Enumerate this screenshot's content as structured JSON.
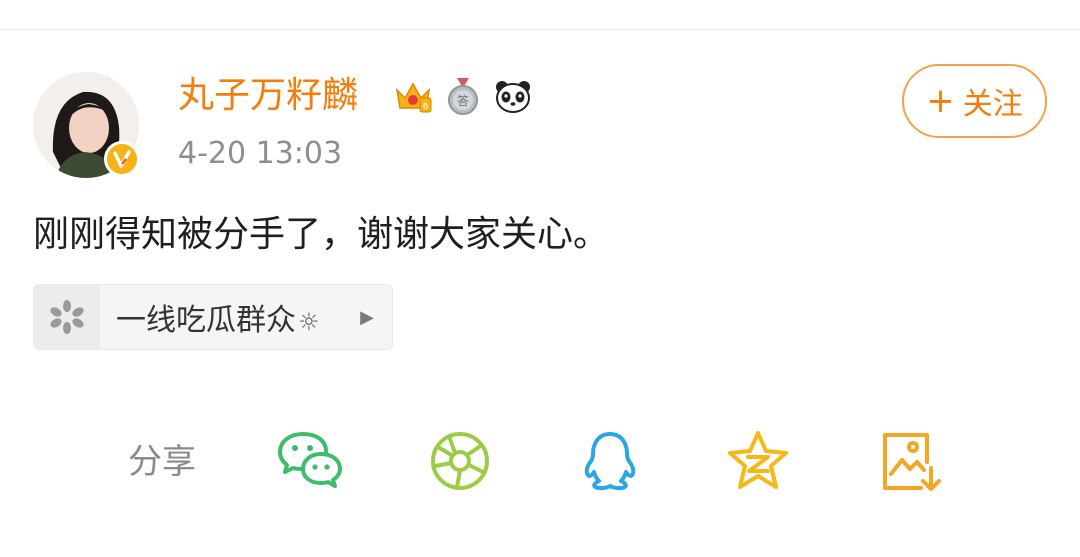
{
  "user": {
    "name": "丸子万籽麟",
    "timestamp": "4-20 13:03",
    "badges": [
      "crown-badge-icon",
      "answer-medal-icon",
      "panda-icon"
    ],
    "verified_badge": "v-verified-icon"
  },
  "follow_button": {
    "plus": "+",
    "label": "关注"
  },
  "post": {
    "text": "刚刚得知被分手了，谢谢大家关心。"
  },
  "source": {
    "label": "一线吃瓜群众",
    "suffix": "☼",
    "arrow": "▶"
  },
  "share": {
    "label": "分享",
    "targets": [
      "wechat-icon",
      "moments-icon",
      "qq-icon",
      "qzone-icon",
      "save-image-icon"
    ]
  },
  "colors": {
    "accent": "#f47d0b",
    "wechat": "#3dbd6a",
    "moments": "#9ccc45",
    "qq": "#2aa5e8",
    "qzone": "#f7b716",
    "save": "#f5a623"
  }
}
